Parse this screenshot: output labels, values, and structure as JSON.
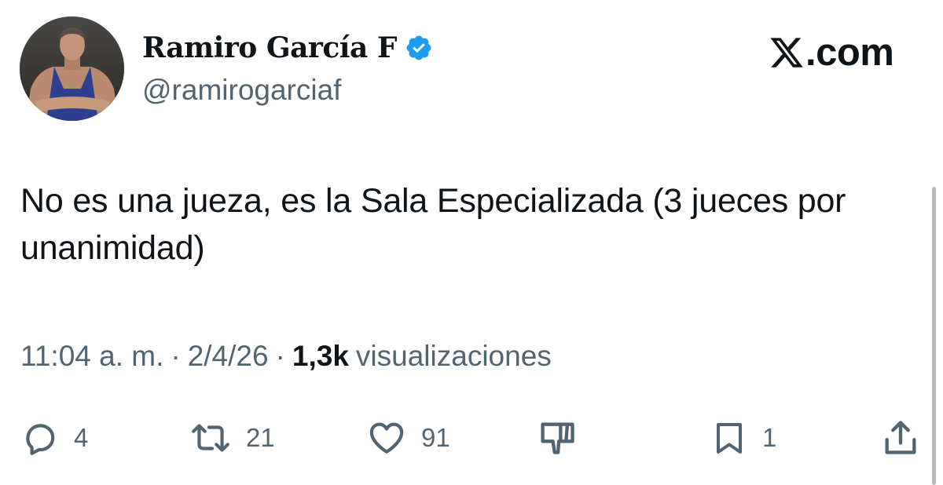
{
  "author": {
    "display_name": "Ramiro García F",
    "handle": "@ramirogarciaf",
    "verified": true,
    "verified_color": "#1d9bf0"
  },
  "brand": {
    "logo_icon": "x-logo-icon",
    "text": ".com"
  },
  "tweet": {
    "text": "No es una jueza, es la Sala Especializada (3 jueces por unanimidad)"
  },
  "meta": {
    "time": "11:04 a. m.",
    "separator": "·",
    "date": "2/4/26",
    "views_count": "1,3k",
    "views_label": "visualizaciones"
  },
  "actions": {
    "reply": {
      "icon": "reply-icon",
      "count": "4"
    },
    "repost": {
      "icon": "repost-icon",
      "count": "21"
    },
    "like": {
      "icon": "heart-icon",
      "count": "91"
    },
    "dislike": {
      "icon": "thumbs-down-icon"
    },
    "bookmark": {
      "icon": "bookmark-icon",
      "count": "1"
    },
    "share": {
      "icon": "share-icon"
    }
  },
  "colors": {
    "text_primary": "#0f1419",
    "text_secondary": "#536471",
    "background": "#ffffff"
  }
}
